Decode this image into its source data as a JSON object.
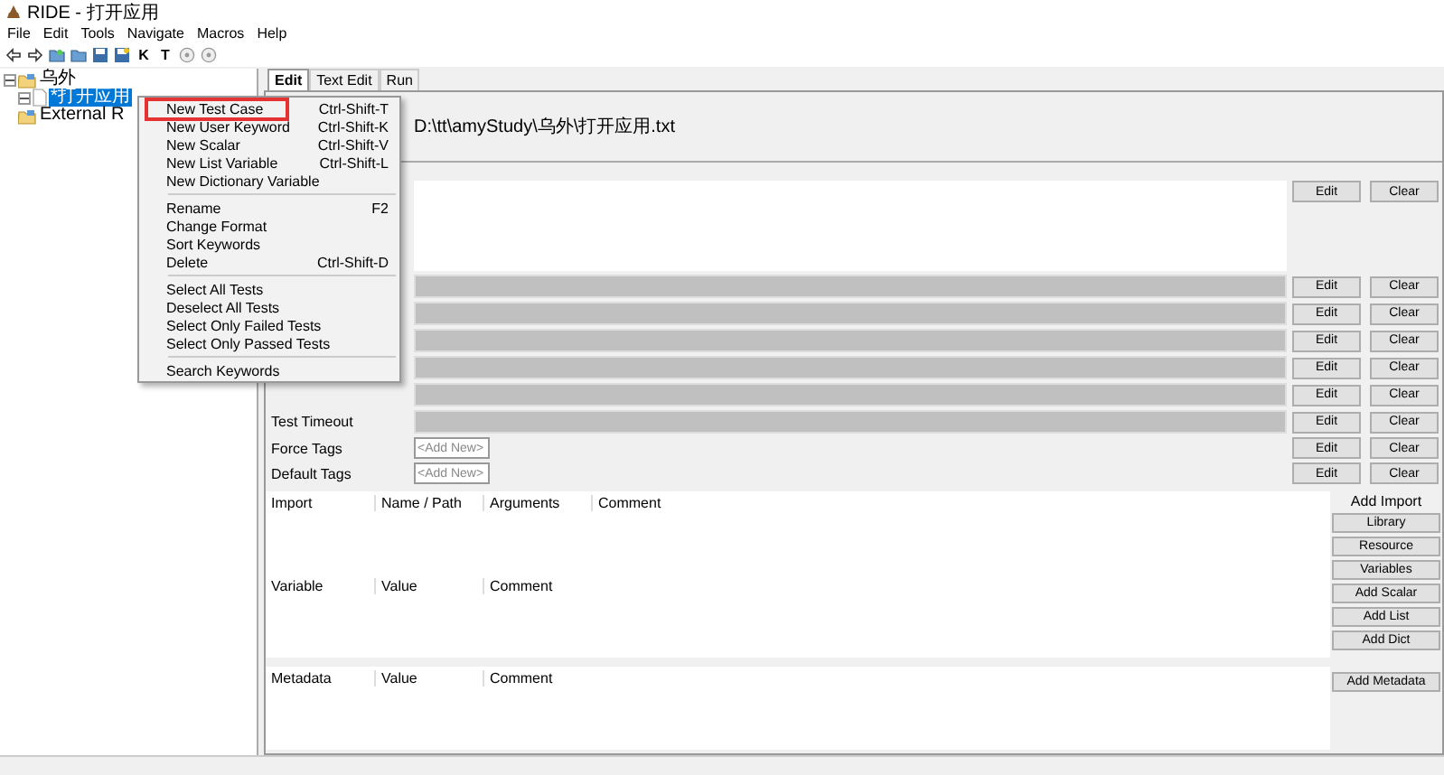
{
  "window": {
    "title": "RIDE - 打开应用"
  },
  "menubar": [
    "File",
    "Edit",
    "Tools",
    "Navigate",
    "Macros",
    "Help"
  ],
  "toolbar": [
    {
      "kind": "back"
    },
    {
      "kind": "forward"
    },
    {
      "kind": "open"
    },
    {
      "kind": "folder"
    },
    {
      "kind": "save"
    },
    {
      "kind": "saveall"
    },
    {
      "kind": "letter",
      "label": "K"
    },
    {
      "kind": "letter",
      "label": "T"
    },
    {
      "kind": "circle"
    },
    {
      "kind": "circle"
    }
  ],
  "tree": [
    {
      "label": "乌外",
      "expanded": true,
      "selected": false,
      "kind": "folder",
      "children": [
        {
          "label": "*打开应用",
          "expanded": true,
          "selected": true,
          "kind": "file"
        }
      ]
    },
    {
      "label": "External R",
      "selected": false,
      "kind": "folder"
    }
  ],
  "tabs": [
    {
      "label": "Edit",
      "selected": true
    },
    {
      "label": "Text Edit",
      "selected": false
    },
    {
      "label": "Run",
      "selected": false
    }
  ],
  "source_path": "D:\\tt\\amyStudy\\乌外\\打开应用.txt",
  "settings": [
    {
      "kind": "doc",
      "buttons": [
        "Edit",
        "Clear"
      ]
    },
    {
      "kind": "bar",
      "buttons": [
        "Edit",
        "Clear"
      ]
    },
    {
      "kind": "bar",
      "buttons": [
        "Edit",
        "Clear"
      ]
    },
    {
      "kind": "bar",
      "buttons": [
        "Edit",
        "Clear"
      ]
    },
    {
      "kind": "bar",
      "buttons": [
        "Edit",
        "Clear"
      ]
    },
    {
      "kind": "bar",
      "buttons": [
        "Edit",
        "Clear"
      ]
    },
    {
      "kind": "bar",
      "label": "Test Timeout",
      "buttons": [
        "Edit",
        "Clear"
      ]
    },
    {
      "kind": "tags",
      "label": "Force Tags",
      "placeholder": "<Add New>",
      "buttons": [
        "Edit",
        "Clear"
      ]
    },
    {
      "kind": "tags",
      "label": "Default Tags",
      "placeholder": "<Add New>",
      "buttons": [
        "Edit",
        "Clear"
      ]
    }
  ],
  "imports": {
    "columns": [
      "Import",
      "Name / Path",
      "Arguments",
      "Comment"
    ]
  },
  "variables": {
    "columns": [
      "Variable",
      "Value",
      "Comment"
    ]
  },
  "import_buttons": {
    "heading": "Add Import",
    "buttons": [
      "Library",
      "Resource",
      "Variables",
      "Add Scalar",
      "Add List",
      "Add Dict"
    ]
  },
  "metadata": {
    "columns": [
      "Metadata",
      "Value",
      "Comment"
    ],
    "button": "Add Metadata"
  },
  "context_menu": [
    [
      {
        "label": "New Test Case",
        "shortcut": "Ctrl-Shift-T",
        "highlighted": true
      },
      {
        "label": "New User Keyword",
        "shortcut": "Ctrl-Shift-K",
        "highlighted": false
      },
      {
        "label": "New Scalar",
        "shortcut": "Ctrl-Shift-V",
        "highlighted": false
      },
      {
        "label": "New List Variable",
        "shortcut": "Ctrl-Shift-L",
        "highlighted": false
      },
      {
        "label": "New Dictionary Variable",
        "highlighted": false
      }
    ],
    [
      {
        "label": "Rename",
        "shortcut": "F2",
        "highlighted": false
      },
      {
        "label": "Change Format",
        "highlighted": false
      },
      {
        "label": "Sort Keywords",
        "highlighted": false
      },
      {
        "label": "Delete",
        "shortcut": "Ctrl-Shift-D",
        "highlighted": false
      }
    ],
    [
      {
        "label": "Select All Tests",
        "highlighted": false
      },
      {
        "label": "Deselect All Tests",
        "highlighted": false
      },
      {
        "label": "Select Only Failed Tests",
        "highlighted": false
      },
      {
        "label": "Select Only Passed Tests",
        "highlighted": false
      }
    ],
    [
      {
        "label": "Search Keywords",
        "highlighted": false
      }
    ]
  ]
}
